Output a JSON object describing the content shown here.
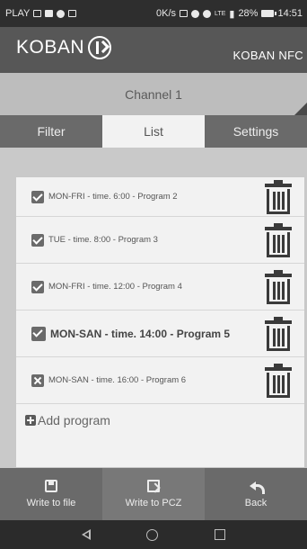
{
  "status_bar": {
    "carrier": "PLAY",
    "speed": "0K/s",
    "network": "LTE",
    "battery": "28%",
    "time": "14:51"
  },
  "header": {
    "logo_text": "KOBAN",
    "brand_right": "KOBAN NFC"
  },
  "channel": {
    "title": "Channel 1"
  },
  "tabs": [
    {
      "label": "Filter",
      "active": false
    },
    {
      "label": "List",
      "active": true
    },
    {
      "label": "Settings",
      "active": false
    }
  ],
  "programs": [
    {
      "text": "MON-FRI - time. 6:00 - Program 2",
      "checked": true
    },
    {
      "text": "TUE - time. 8:00 - Program 3",
      "checked": true
    },
    {
      "text": "MON-FRI - time. 12:00 - Program 4",
      "checked": true
    },
    {
      "text": "MON-SAN - time. 14:00 - Program 5",
      "checked": true,
      "selected": true
    },
    {
      "text": "MON-SAN - time. 16:00 - Program 6",
      "checked": false
    }
  ],
  "add_program": "Add program",
  "bottom_bar": {
    "write_file": "Write to file",
    "write_pcz": "Write to PCZ",
    "back": "Back"
  },
  "colors": {
    "header": "#575757",
    "tabs": "#6a6a6a",
    "active_tab": "#f2f2f2",
    "panel": "#f2f2f2"
  },
  "icons": {
    "delete": "trash-icon",
    "add": "plus-square-icon",
    "write_file": "floppy-icon",
    "write_pcz": "export-icon",
    "back": "back-arrow-icon"
  }
}
